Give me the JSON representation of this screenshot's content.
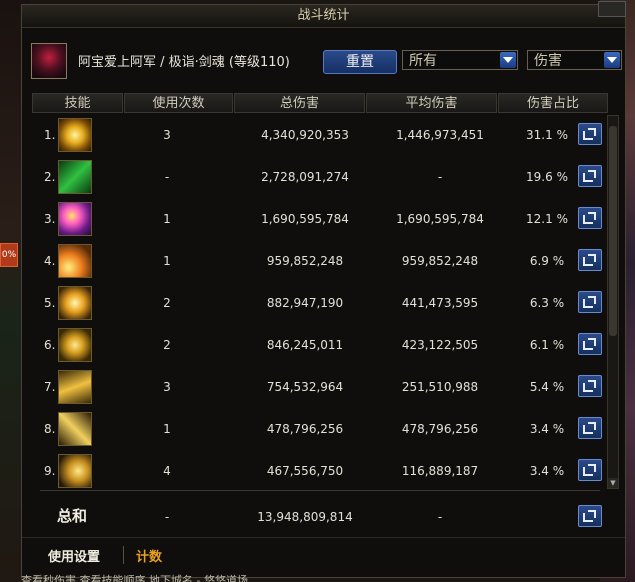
{
  "window": {
    "title": "战斗统计"
  },
  "header": {
    "character": "阿宝爱上阿军 / 极诣·剑魂 (等级110)",
    "reset_label": "重置",
    "filter_target": "所有",
    "filter_metric": "伤害"
  },
  "columns": [
    "技能",
    "使用次数",
    "总伤害",
    "平均伤害",
    "伤害占比"
  ],
  "rows": [
    {
      "rank": "1.",
      "count": "3",
      "total": "4,340,920,353",
      "avg": "1,446,973,451",
      "pct": "31.1 %",
      "icon": "yellow-swirl-skill-icon"
    },
    {
      "rank": "2.",
      "count": "-",
      "total": "2,728,091,274",
      "avg": "-",
      "pct": "19.6 %",
      "icon": "green-rune-skill-icon"
    },
    {
      "rank": "3.",
      "count": "1",
      "total": "1,690,595,784",
      "avg": "1,690,595,784",
      "pct": "12.1 %",
      "icon": "purple-burst-skill-icon"
    },
    {
      "rank": "4.",
      "count": "1",
      "total": "959,852,248",
      "avg": "959,852,248",
      "pct": "6.9 %",
      "icon": "orange-slash-skill-icon"
    },
    {
      "rank": "5.",
      "count": "2",
      "total": "882,947,190",
      "avg": "441,473,595",
      "pct": "6.3 %",
      "icon": "lightning-star-skill-icon"
    },
    {
      "rank": "6.",
      "count": "2",
      "total": "846,245,011",
      "avg": "423,122,505",
      "pct": "6.1 %",
      "icon": "crescent-slash-skill-icon"
    },
    {
      "rank": "7.",
      "count": "3",
      "total": "754,532,964",
      "avg": "251,510,988",
      "pct": "5.4 %",
      "icon": "triple-slash-skill-icon"
    },
    {
      "rank": "8.",
      "count": "1",
      "total": "478,796,256",
      "avg": "478,796,256",
      "pct": "3.4 %",
      "icon": "sword-cross-skill-icon"
    },
    {
      "rank": "9.",
      "count": "4",
      "total": "467,556,750",
      "avg": "116,889,187",
      "pct": "3.4 %",
      "icon": "arc-slash-skill-icon"
    }
  ],
  "summary": {
    "label": "总和",
    "count": "-",
    "total": "13,948,809,814",
    "avg": "-"
  },
  "tabs": {
    "settings": "使用设置",
    "count": "计数"
  },
  "left_badge": "0%",
  "bottom_strip": "查看秒伤害   查看技能顺序   地下城名 - 悠悠道场",
  "colors": {
    "accent_blue": "#1e3f7a",
    "tab_active": "#f0ece0",
    "tab_inactive": "#e8a020"
  }
}
